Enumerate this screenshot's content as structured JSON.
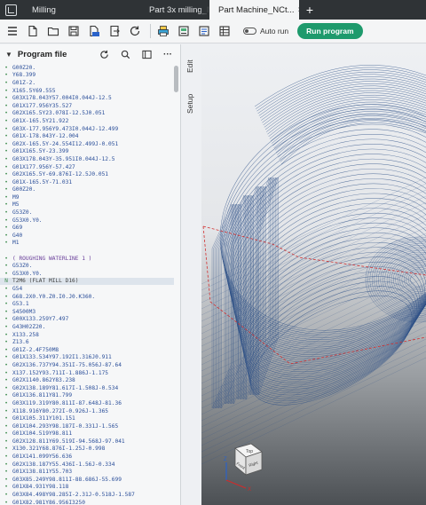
{
  "tabs": [
    {
      "label": "Milling"
    },
    {
      "label": "Part 3x milling_NC..."
    },
    {
      "label": "Part Machine_NCt...",
      "close": "×"
    }
  ],
  "tab_add": "+",
  "toolbar": {
    "autorun_label": "Auto run",
    "run_label": "Run program",
    "run_color": "#1e9a6c"
  },
  "panel": {
    "title": "Program file",
    "more": "···"
  },
  "side_tabs": {
    "edit": "Edit",
    "setup": "Setup"
  },
  "cube_labels": {
    "top": "Top",
    "front": "Front",
    "right": "Right",
    "z": "Z",
    "x": "X"
  },
  "code_lines": [
    {
      "text": "G00Z20."
    },
    {
      "text": "Y68.399"
    },
    {
      "text": "G01Z-2."
    },
    {
      "text": "X165.5Y69.555"
    },
    {
      "text": "G03X178.043Y57.004I0.044J-12.5"
    },
    {
      "text": "G01X177.956Y35.527"
    },
    {
      "text": "G02X165.5Y23.078I-12.5J0.051"
    },
    {
      "text": "G01X-165.5Y21.922"
    },
    {
      "text": "G03X-177.956Y9.473I0.044J-12.499"
    },
    {
      "text": "G01X-178.043Y-12.004"
    },
    {
      "text": "G02X-165.5Y-24.554I12.499J-0.051"
    },
    {
      "text": "G01X165.5Y-23.399"
    },
    {
      "text": "G03X178.043Y-35.951I0.044J-12.5"
    },
    {
      "text": "G01X177.956Y-57.427"
    },
    {
      "text": "G02X165.5Y-69.876I-12.5J0.051"
    },
    {
      "text": "G01X-165.5Y-71.031"
    },
    {
      "text": "G00Z20."
    },
    {
      "text": "M9"
    },
    {
      "text": "M5"
    },
    {
      "text": "G53Z0."
    },
    {
      "text": "G53X0.Y0."
    },
    {
      "text": "G69"
    },
    {
      "text": "G40"
    },
    {
      "text": "M1"
    },
    {
      "text": ""
    },
    {
      "text": "( ROUGHING WATERLINE 1 )",
      "type": "comment"
    },
    {
      "text": "G53Z0."
    },
    {
      "text": "G53X0.Y0."
    },
    {
      "text": "T2M6 (FLAT MILL D16)",
      "type": "active",
      "marker": "N"
    },
    {
      "text": "G54"
    },
    {
      "text": "G68.2X0.Y0.Z0.I0.J0.K360."
    },
    {
      "text": "G53.1"
    },
    {
      "text": "S4500M3"
    },
    {
      "text": "G00X133.259Y7.497"
    },
    {
      "text": "G43H02Z20."
    },
    {
      "text": "X133.258"
    },
    {
      "text": "Z13.6"
    },
    {
      "text": "G01Z-2.4F750M8"
    },
    {
      "text": "G01X133.534Y97.192I1.316J0.911"
    },
    {
      "text": "G02X136.737Y94.351I-75.056J-87.64"
    },
    {
      "text": "X137.152Y93.711I-1.886J-1.175"
    },
    {
      "text": "G02X1140.862Y83.238"
    },
    {
      "text": "G02X138.189Y81.617I-1.508J-0.534"
    },
    {
      "text": "G01X136.811Y81.799"
    },
    {
      "text": "G03X119.319Y80.811I-87.648J-81.36"
    },
    {
      "text": "X118.916Y80.272I-0.926J-1.365"
    },
    {
      "text": "G01X105.311Y101.151"
    },
    {
      "text": "G01X104.293Y98.187I-0.331J-1.565"
    },
    {
      "text": "G01X104.519Y98.811"
    },
    {
      "text": "G02X128.811Y69.519I-94.568J-97.041"
    },
    {
      "text": "X130.321Y68.876I-1.25J-0.998"
    },
    {
      "text": "G01X141.099Y56.636"
    },
    {
      "text": "G02X138.187Y55.436I-1.56J-0.334"
    },
    {
      "text": "G01X138.811Y55.703"
    },
    {
      "text": "G03X85.249Y98.811I-88.686J-55.699"
    },
    {
      "text": "G01X84.931Y98.118"
    },
    {
      "text": "G03X84.498Y98.285I-2.31J-0.518J-1.587"
    },
    {
      "text": "G01X82.981Y86.956I3250"
    }
  ]
}
